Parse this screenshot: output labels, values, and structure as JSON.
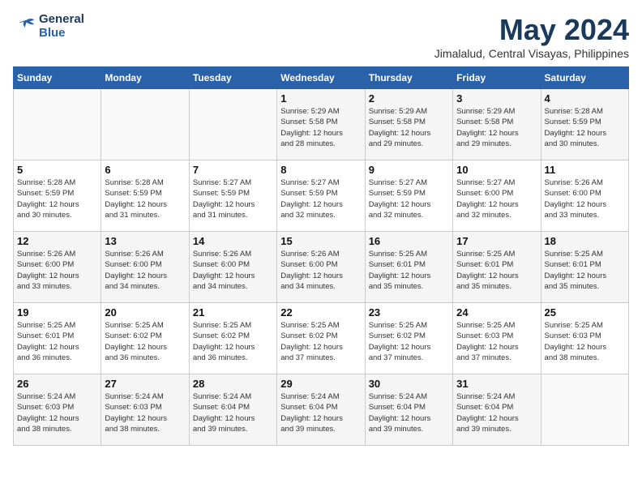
{
  "header": {
    "logo": {
      "line1": "General",
      "line2": "Blue"
    },
    "title": "May 2024",
    "location": "Jimalalud, Central Visayas, Philippines"
  },
  "weekdays": [
    "Sunday",
    "Monday",
    "Tuesday",
    "Wednesday",
    "Thursday",
    "Friday",
    "Saturday"
  ],
  "weeks": [
    [
      {
        "day": "",
        "info": ""
      },
      {
        "day": "",
        "info": ""
      },
      {
        "day": "",
        "info": ""
      },
      {
        "day": "1",
        "info": "Sunrise: 5:29 AM\nSunset: 5:58 PM\nDaylight: 12 hours\nand 28 minutes."
      },
      {
        "day": "2",
        "info": "Sunrise: 5:29 AM\nSunset: 5:58 PM\nDaylight: 12 hours\nand 29 minutes."
      },
      {
        "day": "3",
        "info": "Sunrise: 5:29 AM\nSunset: 5:58 PM\nDaylight: 12 hours\nand 29 minutes."
      },
      {
        "day": "4",
        "info": "Sunrise: 5:28 AM\nSunset: 5:59 PM\nDaylight: 12 hours\nand 30 minutes."
      }
    ],
    [
      {
        "day": "5",
        "info": "Sunrise: 5:28 AM\nSunset: 5:59 PM\nDaylight: 12 hours\nand 30 minutes."
      },
      {
        "day": "6",
        "info": "Sunrise: 5:28 AM\nSunset: 5:59 PM\nDaylight: 12 hours\nand 31 minutes."
      },
      {
        "day": "7",
        "info": "Sunrise: 5:27 AM\nSunset: 5:59 PM\nDaylight: 12 hours\nand 31 minutes."
      },
      {
        "day": "8",
        "info": "Sunrise: 5:27 AM\nSunset: 5:59 PM\nDaylight: 12 hours\nand 32 minutes."
      },
      {
        "day": "9",
        "info": "Sunrise: 5:27 AM\nSunset: 5:59 PM\nDaylight: 12 hours\nand 32 minutes."
      },
      {
        "day": "10",
        "info": "Sunrise: 5:27 AM\nSunset: 6:00 PM\nDaylight: 12 hours\nand 32 minutes."
      },
      {
        "day": "11",
        "info": "Sunrise: 5:26 AM\nSunset: 6:00 PM\nDaylight: 12 hours\nand 33 minutes."
      }
    ],
    [
      {
        "day": "12",
        "info": "Sunrise: 5:26 AM\nSunset: 6:00 PM\nDaylight: 12 hours\nand 33 minutes."
      },
      {
        "day": "13",
        "info": "Sunrise: 5:26 AM\nSunset: 6:00 PM\nDaylight: 12 hours\nand 34 minutes."
      },
      {
        "day": "14",
        "info": "Sunrise: 5:26 AM\nSunset: 6:00 PM\nDaylight: 12 hours\nand 34 minutes."
      },
      {
        "day": "15",
        "info": "Sunrise: 5:26 AM\nSunset: 6:00 PM\nDaylight: 12 hours\nand 34 minutes."
      },
      {
        "day": "16",
        "info": "Sunrise: 5:25 AM\nSunset: 6:01 PM\nDaylight: 12 hours\nand 35 minutes."
      },
      {
        "day": "17",
        "info": "Sunrise: 5:25 AM\nSunset: 6:01 PM\nDaylight: 12 hours\nand 35 minutes."
      },
      {
        "day": "18",
        "info": "Sunrise: 5:25 AM\nSunset: 6:01 PM\nDaylight: 12 hours\nand 35 minutes."
      }
    ],
    [
      {
        "day": "19",
        "info": "Sunrise: 5:25 AM\nSunset: 6:01 PM\nDaylight: 12 hours\nand 36 minutes."
      },
      {
        "day": "20",
        "info": "Sunrise: 5:25 AM\nSunset: 6:02 PM\nDaylight: 12 hours\nand 36 minutes."
      },
      {
        "day": "21",
        "info": "Sunrise: 5:25 AM\nSunset: 6:02 PM\nDaylight: 12 hours\nand 36 minutes."
      },
      {
        "day": "22",
        "info": "Sunrise: 5:25 AM\nSunset: 6:02 PM\nDaylight: 12 hours\nand 37 minutes."
      },
      {
        "day": "23",
        "info": "Sunrise: 5:25 AM\nSunset: 6:02 PM\nDaylight: 12 hours\nand 37 minutes."
      },
      {
        "day": "24",
        "info": "Sunrise: 5:25 AM\nSunset: 6:03 PM\nDaylight: 12 hours\nand 37 minutes."
      },
      {
        "day": "25",
        "info": "Sunrise: 5:25 AM\nSunset: 6:03 PM\nDaylight: 12 hours\nand 38 minutes."
      }
    ],
    [
      {
        "day": "26",
        "info": "Sunrise: 5:24 AM\nSunset: 6:03 PM\nDaylight: 12 hours\nand 38 minutes."
      },
      {
        "day": "27",
        "info": "Sunrise: 5:24 AM\nSunset: 6:03 PM\nDaylight: 12 hours\nand 38 minutes."
      },
      {
        "day": "28",
        "info": "Sunrise: 5:24 AM\nSunset: 6:04 PM\nDaylight: 12 hours\nand 39 minutes."
      },
      {
        "day": "29",
        "info": "Sunrise: 5:24 AM\nSunset: 6:04 PM\nDaylight: 12 hours\nand 39 minutes."
      },
      {
        "day": "30",
        "info": "Sunrise: 5:24 AM\nSunset: 6:04 PM\nDaylight: 12 hours\nand 39 minutes."
      },
      {
        "day": "31",
        "info": "Sunrise: 5:24 AM\nSunset: 6:04 PM\nDaylight: 12 hours\nand 39 minutes."
      },
      {
        "day": "",
        "info": ""
      }
    ]
  ]
}
